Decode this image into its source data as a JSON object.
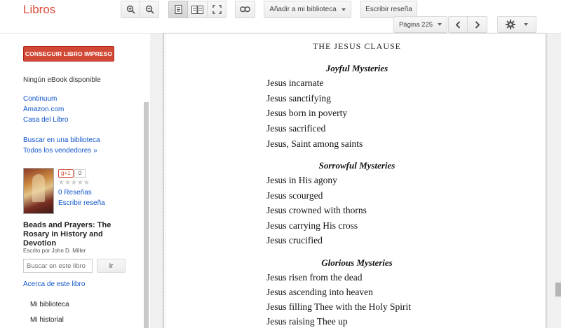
{
  "header": {
    "app_title": "Libros",
    "add_library_label": "Añadir a mi biblioteca",
    "write_review_label": "Escribir reseña",
    "page_select_label": "Página 225"
  },
  "sidebar": {
    "buy_button_label": "CONSEGUIR LIBRO IMPRESO",
    "no_ebook": "Ningún eBook disponible",
    "sellers": [
      "Continuum",
      "Amazon.com",
      "Casa del Libro"
    ],
    "library_link": "Buscar en una biblioteca",
    "all_sellers_link": "Todos los vendedores »",
    "gplus_label": "g+1",
    "gplus_count": "0",
    "stars": "★★★★★",
    "reviews_link": "0 Reseñas",
    "write_review_link": "Escribir reseña",
    "book_title": "Beads and Prayers: The Rosary in History and Devotion",
    "author": "Escrito por John D. Miller",
    "search_placeholder": "Buscar en este libro",
    "search_button": "Ir",
    "about_link": "Acerca de este libro",
    "nav_items": [
      "Mi biblioteca",
      "Mi historial"
    ]
  },
  "reader": {
    "running_head": "THE JESUS CLAUSE",
    "sections": [
      {
        "title": "Joyful Mysteries",
        "lines": [
          "Jesus incarnate",
          "Jesus sanctifying",
          "Jesus born in poverty",
          "Jesus sacrificed",
          "Jesus, Saint among saints"
        ]
      },
      {
        "title": "Sorrowful Mysteries",
        "lines": [
          "Jesus in His agony",
          "Jesus scourged",
          "Jesus crowned with thorns",
          "Jesus carrying His cross",
          "Jesus crucified"
        ]
      },
      {
        "title": "Glorious Mysteries",
        "lines": [
          "Jesus risen from the dead",
          "Jesus ascending into heaven",
          "Jesus filling Thee with the Holy Spirit",
          "Jesus raising Thee up"
        ]
      }
    ]
  },
  "colors": {
    "brand_red": "#dd4b39",
    "buy_button": "#d14836",
    "link_blue": "#1155cc"
  },
  "icons": [
    "zoom-in-icon",
    "zoom-out-icon",
    "single-page-icon",
    "two-page-icon",
    "fullscreen-icon",
    "link-icon",
    "chevron-left-icon",
    "chevron-right-icon",
    "gear-icon",
    "dropdown-caret-icon"
  ]
}
